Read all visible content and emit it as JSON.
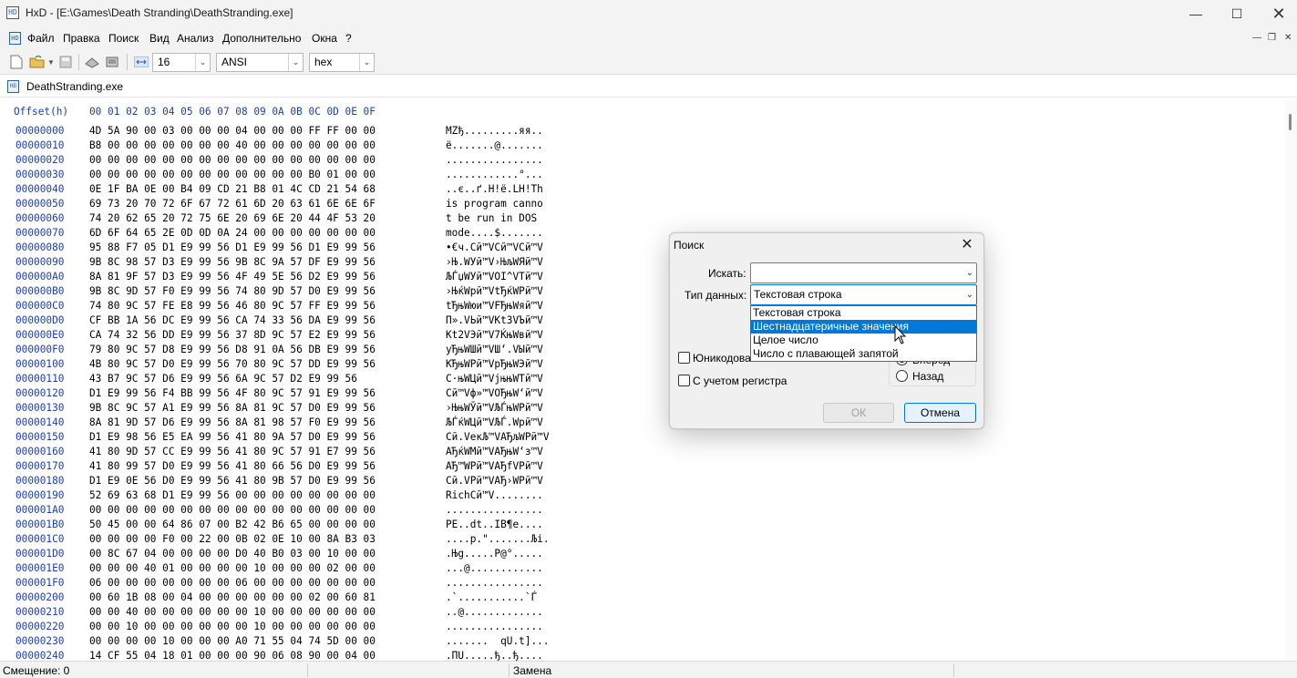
{
  "window": {
    "title": "HxD - [E:\\Games\\Death Stranding\\DeathStranding.exe]",
    "minimize_icon": "minimize-icon",
    "maximize_icon": "maximize-icon",
    "close_icon": "close-icon"
  },
  "menu": {
    "items": [
      "Файл",
      "Правка",
      "Поиск",
      "Вид",
      "Анализ",
      "Дополнительно",
      "Окна",
      "?"
    ]
  },
  "toolbar": {
    "bytes_per_row": "16",
    "charset": "ANSI",
    "offset_base": "hex"
  },
  "tab": {
    "label": "DeathStranding.exe"
  },
  "hex": {
    "offset_header": "Offset(h)",
    "column_header": "00 01 02 03 04 05 06 07 08 09 0A 0B 0C 0D 0E 0F",
    "rows": [
      {
        "off": "00000000",
        "bytes": "4D 5A 90 00 03 00 00 00 04 00 00 00 FF FF 00 00",
        "text": "MZђ.........яя.."
      },
      {
        "off": "00000010",
        "bytes": "B8 00 00 00 00 00 00 00 40 00 00 00 00 00 00 00",
        "text": "ё.......@......."
      },
      {
        "off": "00000020",
        "bytes": "00 00 00 00 00 00 00 00 00 00 00 00 00 00 00 00",
        "text": "................"
      },
      {
        "off": "00000030",
        "bytes": "00 00 00 00 00 00 00 00 00 00 00 00 B0 01 00 00",
        "text": "............°..."
      },
      {
        "off": "00000040",
        "bytes": "0E 1F BA 0E 00 B4 09 CD 21 B8 01 4C CD 21 54 68",
        "text": "..є..ґ.Н!ё.LН!Th"
      },
      {
        "off": "00000050",
        "bytes": "69 73 20 70 72 6F 67 72 61 6D 20 63 61 6E 6E 6F",
        "text": "is program canno"
      },
      {
        "off": "00000060",
        "bytes": "74 20 62 65 20 72 75 6E 20 69 6E 20 44 4F 53 20",
        "text": "t be run in DOS "
      },
      {
        "off": "00000070",
        "bytes": "6D 6F 64 65 2E 0D 0D 0A 24 00 00 00 00 00 00 00",
        "text": "mode....$......."
      },
      {
        "off": "00000080",
        "bytes": "95 88 F7 05 D1 E9 99 56 D1 E9 99 56 D1 E9 99 56",
        "text": "•€ч.Сй™VСй™VСй™V"
      },
      {
        "off": "00000090",
        "bytes": "9B 8C 98 57 D3 E9 99 56 9B 8C 9A 57 DF E9 99 56",
        "text": "›Њ.WУй™V›ЊљWЯй™V"
      },
      {
        "off": "000000A0",
        "bytes": "8A 81 9F 57 D3 E9 99 56 4F 49 5E 56 D2 E9 99 56",
        "text": "ЉЃџWУй™VOI^VТй™V"
      },
      {
        "off": "000000B0",
        "bytes": "9B 8C 9D 57 F0 E9 99 56 74 80 9D 57 D0 E9 99 56",
        "text": "›ЊќWрй™VtЂќWРй™V"
      },
      {
        "off": "000000C0",
        "bytes": "74 80 9C 57 FE E8 99 56 46 80 9C 57 FF E9 99 56",
        "text": "tЂњWюи™VFЂњWяй™V"
      },
      {
        "off": "000000D0",
        "bytes": "CF BB 1A 56 DC E9 99 56 CA 74 33 56 DA E9 99 56",
        "text": "П».VЬй™VКt3VЪй™V"
      },
      {
        "off": "000000E0",
        "bytes": "CA 74 32 56 DD E9 99 56 37 8D 9C 57 E2 E9 99 56",
        "text": "Кt2VЭй™V7ЌњWвй™V"
      },
      {
        "off": "000000F0",
        "bytes": "79 80 9C 57 D8 E9 99 56 D8 91 0A 56 DB E9 99 56",
        "text": "yЂњWШй™VШ‘.VЫй™V"
      },
      {
        "off": "00000100",
        "bytes": "4B 80 9C 57 D0 E9 99 56 70 80 9C 57 DD E9 99 56",
        "text": "KЂњWРй™VpЂњWЭй™V"
      },
      {
        "off": "00000110",
        "bytes": "43 B7 9C 57 D6 E9 99 56 6A 9C 57 D2 E9 99 56",
        "text": "C·њWЦй™VjњњWТй™V"
      },
      {
        "off": "00000120",
        "bytes": "D1 E9 99 56 F4 BB 99 56 4F 80 9C 57 91 E9 99 56",
        "text": "Сй™Vф»™VOЂњW‘й™V"
      },
      {
        "off": "00000130",
        "bytes": "9B 8C 9C 57 A1 E9 99 56 8A 81 9C 57 D0 E9 99 56",
        "text": "›ЊњWЎй™VЉЃњWРй™V"
      },
      {
        "off": "00000140",
        "bytes": "8A 81 9D 57 D6 E9 99 56 8A 81 98 57 F0 E9 99 56",
        "text": "ЉЃќWЦй™VЉЃ.Wрй™V"
      },
      {
        "off": "00000150",
        "bytes": "D1 E9 98 56 E5 EA 99 56 41 80 9A 57 D0 E9 99 56",
        "text": "Сй.VекЉ™VAЂљWРй™V"
      },
      {
        "off": "00000160",
        "bytes": "41 80 9D 57 CC E9 99 56 41 80 9C 57 91 E7 99 56",
        "text": "AЂќWМй™VAЂњW‘з™V"
      },
      {
        "off": "00000170",
        "bytes": "41 80 99 57 D0 E9 99 56 41 80 66 56 D0 E9 99 56",
        "text": "AЂ™WРй™VAЂfVРй™V"
      },
      {
        "off": "00000180",
        "bytes": "D1 E9 0E 56 D0 E9 99 56 41 80 9B 57 D0 E9 99 56",
        "text": "Сй.VРй™VAЂ›WРй™V"
      },
      {
        "off": "00000190",
        "bytes": "52 69 63 68 D1 E9 99 56 00 00 00 00 00 00 00 00",
        "text": "RichСй™V........"
      },
      {
        "off": "000001A0",
        "bytes": "00 00 00 00 00 00 00 00 00 00 00 00 00 00 00 00",
        "text": "................"
      },
      {
        "off": "000001B0",
        "bytes": "50 45 00 00 64 86 07 00 B2 42 B6 65 00 00 00 00",
        "text": "PE..dt..IB¶e...."
      },
      {
        "off": "000001C0",
        "bytes": "00 00 00 00 F0 00 22 00 0B 02 0E 10 00 8A B3 03",
        "text": "....p.\".......Љі."
      },
      {
        "off": "000001D0",
        "bytes": "00 8C 67 04 00 00 00 00 D0 40 B0 03 00 10 00 00",
        "text": ".Њg.....Р@°....."
      },
      {
        "off": "000001E0",
        "bytes": "00 00 00 40 01 00 00 00 00 10 00 00 00 02 00 00",
        "text": "...@............"
      },
      {
        "off": "000001F0",
        "bytes": "06 00 00 00 00 00 00 00 06 00 00 00 00 00 00 00",
        "text": "................"
      },
      {
        "off": "00000200",
        "bytes": "00 60 1B 08 00 04 00 00 00 00 00 00 02 00 60 81",
        "text": ".`...........`Ѓ"
      },
      {
        "off": "00000210",
        "bytes": "00 00 40 00 00 00 00 00 00 10 00 00 00 00 00 00",
        "text": "..@............."
      },
      {
        "off": "00000220",
        "bytes": "00 00 10 00 00 00 00 00 00 10 00 00 00 00 00 00",
        "text": "................"
      },
      {
        "off": "00000230",
        "bytes": "00 00 00 00 10 00 00 00 A0 71 55 04 74 5D 00 00",
        "text": ".......  qU.t]..."
      },
      {
        "off": "00000240",
        "bytes": "14 CF 55 04 18 01 00 00 00 90 06 08 90 00 04 00",
        "text": ".ПU.....ђ..ђ...."
      }
    ]
  },
  "status": {
    "offset": "Смещение: 0",
    "mode": "Замена"
  },
  "dialog": {
    "title": "Поиск",
    "search_label": "Искать:",
    "search_value": "",
    "datatype_label": "Тип данных:",
    "datatype_value": "Текстовая строка",
    "dropdown_options": [
      "Текстовая строка",
      "Шестнадцатеричные значения",
      "Целое число",
      "Число с плавающей запятой"
    ],
    "dropdown_selected_index": 1,
    "unicode_label": "Юникодова",
    "case_label": "С учетом регистра",
    "forward_label": "Вперед",
    "backward_label": "Назад",
    "ok_label": "ОК",
    "cancel_label": "Отмена"
  }
}
